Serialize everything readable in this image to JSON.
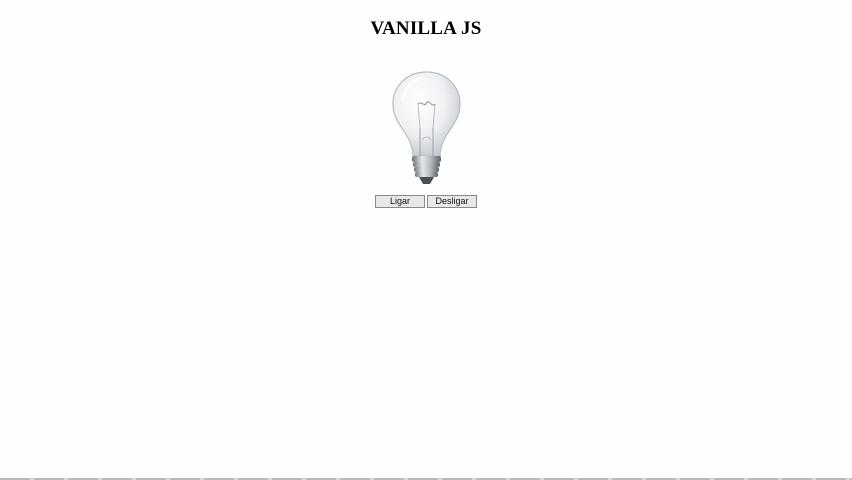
{
  "page": {
    "title": "VANILLA JS"
  },
  "bulb": {
    "icon": "lightbulb-off-icon",
    "state": "off"
  },
  "controls": {
    "on_label": "Ligar",
    "off_label": "Desligar"
  },
  "colors": {
    "background": "#fefefe",
    "button_bg": "#e8e8e8",
    "button_border": "#8a8a8a"
  }
}
